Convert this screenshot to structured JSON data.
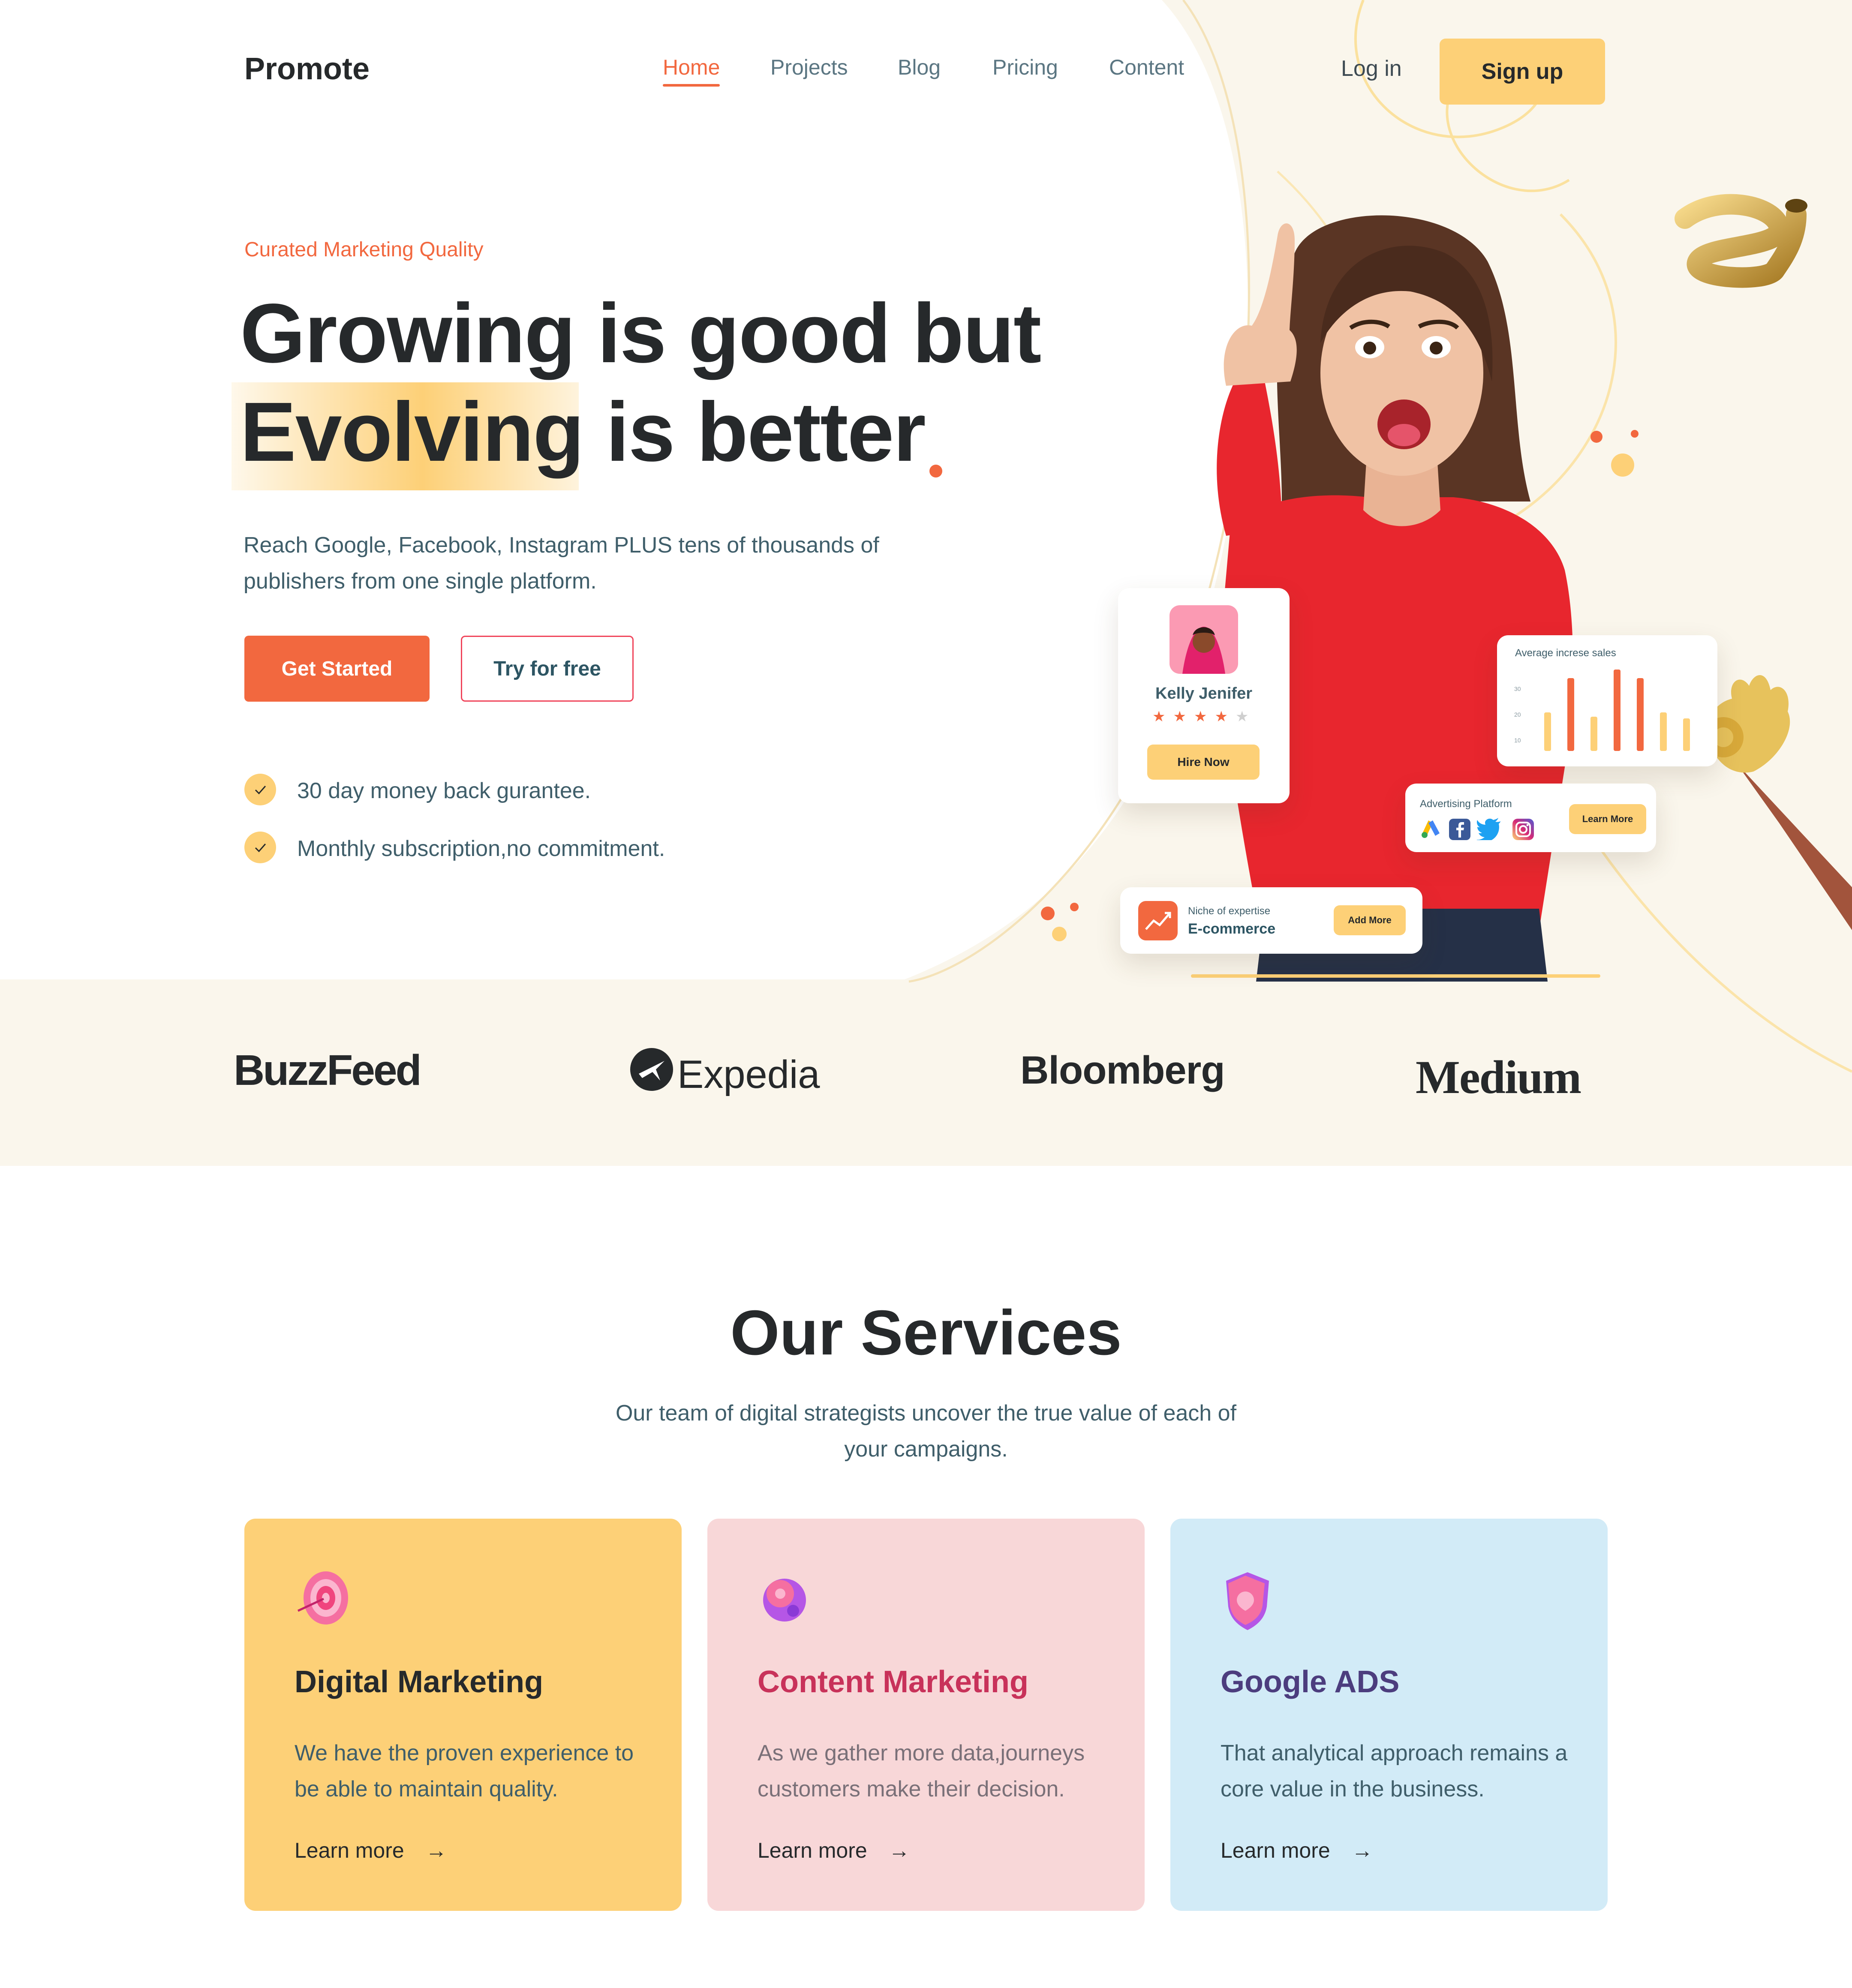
{
  "nav": {
    "brand": "Promote",
    "links": [
      {
        "label": "Home",
        "active": true
      },
      {
        "label": "Projects",
        "active": false
      },
      {
        "label": "Blog",
        "active": false
      },
      {
        "label": "Pricing",
        "active": false
      },
      {
        "label": "Content",
        "active": false
      }
    ],
    "login": "Log in",
    "signup": "Sign up"
  },
  "hero": {
    "eyebrow": "Curated Marketing Quality",
    "headline_line1": "Growing is good but",
    "headline_highlight": "Evolving",
    "headline_line2_rest": "is better",
    "description": "Reach Google, Facebook, Instagram PLUS tens of thousands of publishers from one single platform.",
    "primary_cta": "Get Started",
    "secondary_cta": "Try for free",
    "checks": [
      "30 day money back gurantee.",
      "Monthly subscription,no commitment."
    ]
  },
  "profile_card": {
    "name": "Kelly Jenifer",
    "rating": 4,
    "rating_max": 5,
    "button": "Hire Now"
  },
  "sales_card": {
    "title": "Average increse sales",
    "ticks": [
      "30",
      "20",
      "10"
    ],
    "bar_values": [
      0.45,
      0.85,
      0.4,
      0.95,
      0.85,
      0.45,
      0.38
    ],
    "bar_colors": [
      "#fdd077",
      "#f2683f",
      "#fdd077",
      "#f2683f",
      "#f2683f",
      "#fdd077",
      "#fdd077"
    ]
  },
  "ad_card": {
    "title": "Advertising Platform",
    "platforms": [
      "google-ads-icon",
      "facebook-icon",
      "twitter-icon",
      "instagram-icon"
    ],
    "button": "Learn More"
  },
  "niche_card": {
    "label": "Niche of expertise",
    "value": "E-commerce",
    "button": "Add More"
  },
  "brands": [
    "BuzzFeed",
    "Expedia",
    "Bloomberg",
    "Medium"
  ],
  "services": {
    "title": "Our Services",
    "subtitle": "Our team of digital strategists uncover the true value of each of your campaigns.",
    "cards": [
      {
        "name": "Digital Marketing",
        "description": "We have the proven experience to be able to maintain quality.",
        "link": "Learn more",
        "icon": "target-icon",
        "bg": "#fdd077",
        "title_color": "#26292b",
        "text_color": "#3f5e6a"
      },
      {
        "name": "Content Marketing",
        "description": "As we gather more data,journeys customers make their decision.",
        "link": "Learn more",
        "icon": "gear-icon",
        "bg": "#f8d7d8",
        "title_color": "#c8325a",
        "text_color": "#7a7078"
      },
      {
        "name": "Google ADS",
        "description": "That analytical approach remains a core value in the business.",
        "link": "Learn more",
        "icon": "shield-icon",
        "bg": "#d2ebf7",
        "title_color": "#4c3d7e",
        "text_color": "#3f5e6a"
      }
    ]
  },
  "colors": {
    "accent": "#f2683f",
    "yellow": "#fdd077",
    "cream": "#faf6ec",
    "dark": "#26292b"
  }
}
